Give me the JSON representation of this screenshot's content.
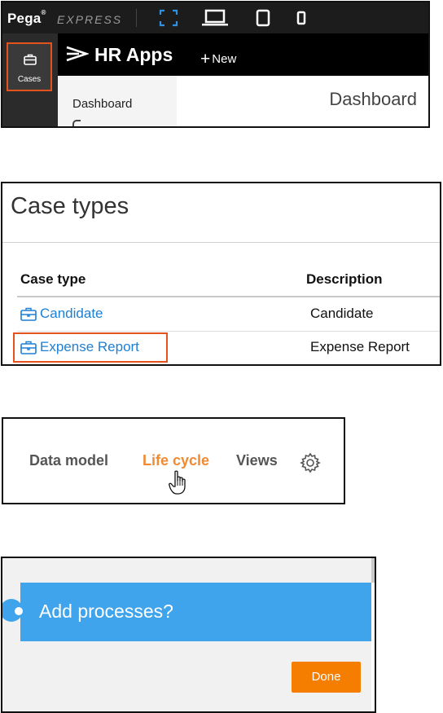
{
  "colors": {
    "accent_orange": "#e4531e",
    "link_blue": "#1e7fd4",
    "banner_blue": "#3fa4ec",
    "done_orange": "#f57d00",
    "active_tab": "#f08a33"
  },
  "panel1": {
    "brand": "Pega",
    "brand_mark": "®",
    "product": "EXPRESS",
    "toolbar_icons": [
      "fullscreen-icon",
      "laptop-icon",
      "tablet-icon",
      "phone-icon"
    ],
    "sidebar": {
      "cases_label": "Cases",
      "cases_icon": "briefcase-icon"
    },
    "app_title": "HR Apps",
    "new_label": "New",
    "nav_items": [
      "Dashboard"
    ],
    "main_title": "Dashboard"
  },
  "panel2": {
    "title": "Case types",
    "columns": [
      "Case type",
      "Description"
    ],
    "rows": [
      {
        "case_type": "Candidate",
        "description": "Candidate"
      },
      {
        "case_type": "Expense Report",
        "description": "Expense Report"
      }
    ]
  },
  "panel3": {
    "tabs": [
      "Data model",
      "Life cycle",
      "Views"
    ],
    "active_tab": "Life cycle",
    "settings_icon": "gear-icon"
  },
  "panel4": {
    "banner_text": "Add processes?",
    "done_label": "Done"
  }
}
